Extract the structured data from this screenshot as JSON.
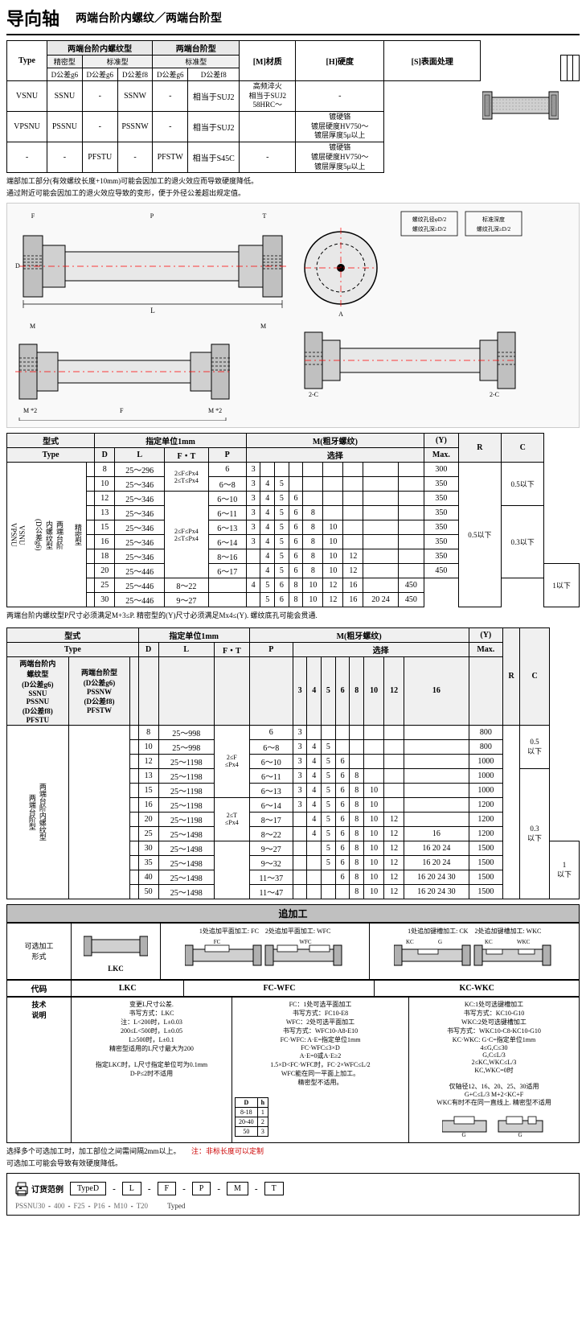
{
  "header": {
    "title": "导向轴",
    "subtitle": "两端台阶内螺纹／两端台阶型"
  },
  "type_table": {
    "col_type": "Type",
    "col_inner": "两端台阶内螺纹型",
    "col_step": "两端台阶型",
    "col_material": "[M]材质",
    "col_hardness": "[H]硬度",
    "col_surface": "[S]表面处理",
    "sub_precision": "精密型",
    "sub_standard": "标准型",
    "sub_cols": [
      "D公差g6",
      "D公差g6",
      "D公差f8",
      "D公差g6",
      "D公差f8"
    ],
    "rows": [
      {
        "model_left1": "VSNU",
        "model_left2": "SSNU",
        "model_left3": "-",
        "model_right1": "SSNW",
        "model_right2": "-",
        "material": "相当于SUJ2",
        "hardness": "高频淬火\n相当于SUJ2\n58HRC～",
        "surface": "-"
      },
      {
        "model_left1": "VPSNU",
        "model_left2": "PSSNU",
        "model_left3": "-",
        "model_right1": "PSSNW",
        "model_right2": "-",
        "material": "相当于SUJ2",
        "hardness": "",
        "surface": "镀硬铬\n镀层硬度HV750～\n镀层厚度5μ以上"
      },
      {
        "model_left1": "-",
        "model_left2": "-",
        "model_left3": "PFSTU",
        "model_right1": "-",
        "model_right2": "PFSTW",
        "material": "相当于S45C",
        "hardness": "-",
        "surface": "镀硬铬\n镀层硬度HV750～\n镀层厚度5μ以上"
      }
    ]
  },
  "notes_top": [
    "端部加工部分(有效螺纹长度+10mm)可能会因加工的退火效应而导致硬度降低。",
    "通过附近可能会因加工的退火效应导致的变形，便于外径公差超出规定值。"
  ],
  "dim_table1": {
    "title": "精密型 两端台阶内螺纹型(D公差g6) VSNU VPSNU",
    "unit": "指定单位1mm",
    "cols": {
      "type": "型式",
      "d": "D",
      "l": "L",
      "ft": "F・T",
      "p": "P",
      "m_label": "M(粗牙螺纹)",
      "m_sub": "选择",
      "y_label": "(Y)",
      "y_sub": "Max.",
      "r": "R",
      "c": "C"
    },
    "rows": [
      {
        "d": "8",
        "l": "25～296",
        "ft_note": "2≤F≤Px4\n2≤T≤Px4",
        "p": "6",
        "m": "3",
        "y": "300"
      },
      {
        "d": "10",
        "l": "25～346",
        "p": "6～8",
        "m": "3 4 5",
        "y": "350"
      },
      {
        "d": "12",
        "l": "25～346",
        "p": "6～10",
        "m": "3 4 5 6",
        "y": "350"
      },
      {
        "d": "13",
        "l": "25～346",
        "p": "6～11",
        "m": "3 4 5 6 8",
        "y": "350"
      },
      {
        "d": "15",
        "l": "25～346",
        "p": "6～13",
        "m": "3 4 5 6 8 10",
        "y": "350"
      },
      {
        "d": "16",
        "l": "25～346",
        "p": "6～14",
        "m": "3 4 5 6 8 10",
        "y": "350"
      },
      {
        "d": "18",
        "l": "25～346",
        "p": "8～16",
        "m": "4 5 6 8 10 12",
        "y": "350"
      },
      {
        "d": "20",
        "l": "25～446",
        "p": "6～17",
        "m": "4 5 6 8 10 12",
        "y": "450"
      },
      {
        "d": "25",
        "l": "25～446",
        "p": "8～22",
        "m": "4 5 6 8 10 12 16",
        "y": "450"
      },
      {
        "d": "30",
        "l": "25～446",
        "p": "9～27",
        "m": "5 6 8 10 12 16 20 24",
        "y": "450"
      }
    ],
    "r_val": "0.5以下",
    "c_vals": [
      "0.5以下",
      "0.3以下",
      "0.3以下",
      "1以下"
    ],
    "note": "两端台阶内螺纹型P尺寸必须满足M+3≤P. 精密型的(Y)尺寸必须满足Mx4≤(Y). 螺纹底孔可能会贯通."
  },
  "dim_table2": {
    "title": "标准型 两端台阶内螺纹型/两端台阶型",
    "unit": "指定单位1mm",
    "rows": [
      {
        "d": "8",
        "l": "25～998",
        "p": "6",
        "m": "3",
        "y": "800"
      },
      {
        "d": "10",
        "l": "25～998",
        "p": "6～8",
        "m": "3 4 5",
        "y": "800"
      },
      {
        "d": "12",
        "l": "25～1198",
        "p": "6～10",
        "m": "3 4 5 6",
        "y": "1000"
      },
      {
        "d": "13",
        "l": "25～1198",
        "p": "6～11",
        "m": "3 4 5 6 8",
        "y": "1000"
      },
      {
        "d": "15",
        "l": "25～1198",
        "p": "6～13",
        "m": "3 4 5 6 8 10",
        "y": "1000"
      },
      {
        "d": "16",
        "l": "25～1198",
        "p": "6～14",
        "m": "3 4 5 6 8 10",
        "y": "1200"
      },
      {
        "d": "20",
        "l": "25～1198",
        "p": "8～17",
        "m": "4 5 6 8 10 12",
        "y": "1200"
      },
      {
        "d": "25",
        "l": "25～1498",
        "p": "8～22",
        "m": "4 5 6 8 10 12 16",
        "y": "1200"
      },
      {
        "d": "30",
        "l": "25～1498",
        "p": "9～27",
        "m": "5 6 8 10 12 16 20 24",
        "y": "1500"
      },
      {
        "d": "35",
        "l": "25～1498",
        "p": "9～32",
        "m": "5 6 8 10 12 16 20 24",
        "y": "1500"
      },
      {
        "d": "40",
        "l": "25～1498",
        "p": "11～37",
        "m": "6 8 10 12 16 20 24 30",
        "y": "1500"
      },
      {
        "d": "50",
        "l": "25～1498",
        "p": "11～47",
        "m": "8 10 12 16 20 24 30",
        "y": "1500"
      }
    ],
    "note": ""
  },
  "post_section": {
    "title": "追加工",
    "sub1_title": "变更L尺寸公差",
    "sub2_title": "可选平面加工",
    "sub3_title": "可选键槽加工",
    "code_row": {
      "label": "代码",
      "lkc": "LKC",
      "fc_wfc": "FC-WFC",
      "kc_wkc": "KC-WKC"
    },
    "lkc_desc": "变更L尺寸公差.\n书写方式：LKC\n注：L<200时，L±0.03\n200≤L<500时，L±0.05\nL≥500时，L±0.1\n精密型适用的L尺寸最大为200\n指定LKC时，L尺寸指定单位可为0.1mm\nD-P≤2时不适用",
    "fc_wfc_desc": "FC：1处可选平面加工\n书写方式：FC10-E8\nWFC：2处可选平面加工\n书写方式：WFC10-A8-E10\nFC·WFC: A·E=指定单位1mm\nFC·WFC≤3×D\nA·E=0或A·E≥2\n1.5×D<FC·WFC时，FC·2×WFC≤L/2\nWFC能在同一平面上加工。\n精密型不适用。",
    "kc_wkc_desc": "KC:1处可选键槽加工\n书写方式：KC10-G10\nWKC:2处可选键槽加工\n书写方式：WKC10-C8-KC10-G10\nKC·WKC: G·C=指定单位1mm\n4≤G,C≤30\nG,C≤L/3\n2≤KC,WKC≤L/3\nKC,WKC=0时\n仅轴径12、16、20、25、30适用\nG+C≤L/3 M+2<KC+F\nWKC有时不在同一直线上. 精密型不适用",
    "dh_table": {
      "d_col": "D",
      "h_col": "h",
      "rows": [
        {
          "d": "8-18",
          "h": "1"
        },
        {
          "d": "20-40",
          "h": "2"
        },
        {
          "d": "50",
          "h": "3"
        }
      ]
    }
  },
  "bottom_note": "选择多个可选加工时，加工部位之间需间隔2mm以上。",
  "footer_note": "注：非标长度可以定制",
  "order_section": {
    "label": "订货范例",
    "items": [
      {
        "label": "TypeD",
        "value": ""
      },
      {
        "label": "L",
        "value": ""
      },
      {
        "label": "F",
        "value": ""
      },
      {
        "label": "P",
        "value": ""
      },
      {
        "label": "M",
        "value": ""
      },
      {
        "label": "T",
        "value": ""
      }
    ],
    "example": "PSSNU30 - 400 - F25 - P16 - M10 - T20"
  },
  "typed_label": "Typed"
}
